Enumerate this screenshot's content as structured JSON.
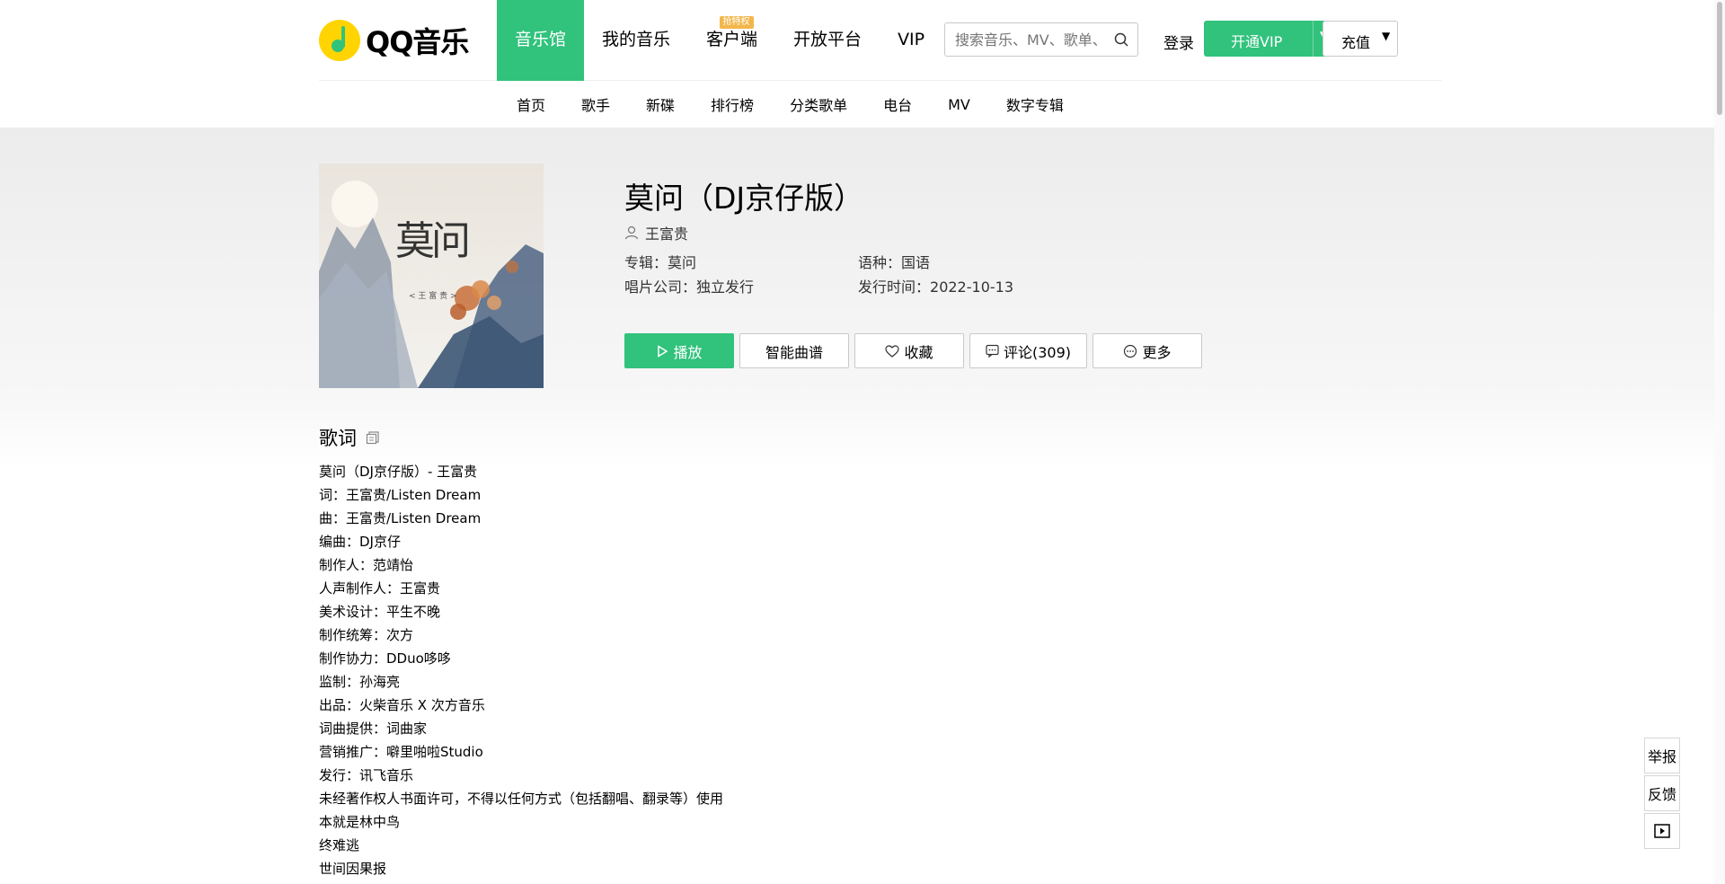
{
  "header": {
    "logo_text": "QQ音乐",
    "nav": [
      {
        "label": "音乐馆",
        "active": true
      },
      {
        "label": "我的音乐"
      },
      {
        "label": "客户端",
        "tag": "抢特权"
      },
      {
        "label": "开放平台"
      },
      {
        "label": "VIP"
      }
    ],
    "search_placeholder": "搜索音乐、MV、歌单、用户",
    "login_label": "登录",
    "vip_label": "开通VIP",
    "charge_label": "充值"
  },
  "subnav": [
    "首页",
    "歌手",
    "新碟",
    "排行榜",
    "分类歌单",
    "电台",
    "MV",
    "数字专辑"
  ],
  "song": {
    "title": "莫问（DJ京仔版）",
    "singer": "王富贵",
    "album_key": "专辑：",
    "album": "莫问",
    "language_key": "语种：",
    "language": "国语",
    "company_key": "唱片公司：",
    "company": "独立发行",
    "release_key": "发行时间：",
    "release_date": "2022-10-13",
    "cover_title": "莫问",
    "cover_artist": "< 王 富 贵 >"
  },
  "actions": {
    "play": "播放",
    "sheet": "智能曲谱",
    "favorite": "收藏",
    "comments": "评论(309)",
    "more": "更多"
  },
  "lyrics": {
    "heading": "歌词",
    "lines": [
      "莫问（DJ京仔版）- 王富贵",
      "词：王富贵/Listen Dream",
      "曲：王富贵/Listen Dream",
      "编曲：DJ京仔",
      "制作人：范靖怡",
      "人声制作人：王富贵",
      "美术设计：平生不晚",
      "制作统筹：次方",
      "制作协力：DDuo哆哆",
      "监制：孙海亮",
      "出品：火柴音乐 X 次方音乐",
      "词曲提供：词曲家",
      "营销推广：噼里啪啦Studio",
      "发行：讯飞音乐",
      "未经著作权人书面许可，不得以任何方式（包括翻唱、翻录等）使用",
      "本就是林中鸟",
      "终难逃",
      "世间因果报"
    ]
  },
  "side_tools": {
    "report": "举报",
    "feedback": "反馈"
  },
  "colors": {
    "brand_green": "#31c27c",
    "tag_orange": "#f2b74c",
    "logo_yellow": "#ffd400"
  }
}
